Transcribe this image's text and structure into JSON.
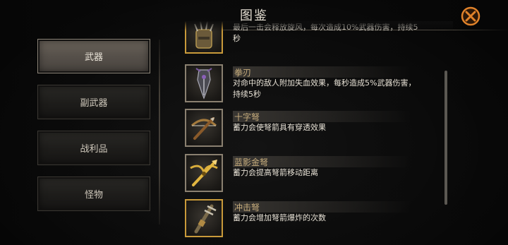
{
  "header": {
    "title": "图鉴"
  },
  "categories": [
    {
      "label": "武器",
      "active": true
    },
    {
      "label": "副武器",
      "active": false
    },
    {
      "label": "战利品",
      "active": false
    },
    {
      "label": "怪物",
      "active": false
    }
  ],
  "items": [
    {
      "name": "",
      "desc_line1": "最后一击会释放旋风，每次造成10%武器伤害，持续5",
      "desc_line2": "秒",
      "icon": "spiked-gauntlet-icon"
    },
    {
      "name": "拳刃",
      "desc_line1": "对命中的敌人附加失血效果，每秒造成5%武器伤害，",
      "desc_line2": "持续5秒",
      "icon": "fist-blade-icon"
    },
    {
      "name": "十字弩",
      "desc_line1": "蓄力会使弩箭具有穿透效果",
      "desc_line2": "",
      "icon": "crossbow-icon"
    },
    {
      "name": "蓝影金弩",
      "desc_line1": "蓄力会提高弩箭移动距离",
      "desc_line2": "",
      "icon": "golden-crossbow-icon"
    },
    {
      "name": "冲击弩",
      "desc_line1": "蓄力会增加弩箭爆炸的次数",
      "desc_line2": "",
      "icon": "impact-crossbow-icon"
    }
  ],
  "colors": {
    "accent_gold": "#c99a3a",
    "close_orange": "#e0822a",
    "name_color": "#c7ad7d"
  }
}
